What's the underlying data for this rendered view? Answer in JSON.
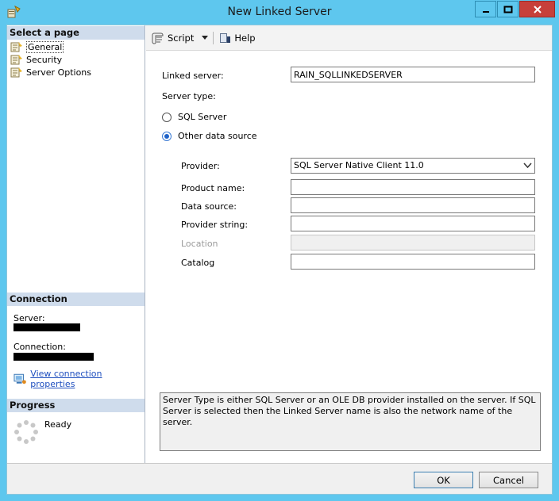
{
  "window": {
    "title": "New Linked Server",
    "controls": {
      "minimize": "minimize",
      "maximize": "maximize",
      "close": "close"
    }
  },
  "left_pane": {
    "select_page_header": "Select a page",
    "pages": [
      {
        "label": "General",
        "selected": true
      },
      {
        "label": "Security",
        "selected": false
      },
      {
        "label": "Server Options",
        "selected": false
      }
    ],
    "connection_header": "Connection",
    "server_label": "Server:",
    "connection_label": "Connection:",
    "view_connection_properties": "View connection properties",
    "progress_header": "Progress",
    "progress_status": "Ready"
  },
  "toolbar": {
    "script_label": "Script",
    "help_label": "Help"
  },
  "form": {
    "linked_server_label": "Linked server:",
    "linked_server_value": "RAIN_SQLLINKEDSERVER",
    "server_type_label": "Server type:",
    "server_type_options": [
      {
        "label": "SQL Server",
        "checked": false
      },
      {
        "label": "Other data source",
        "checked": true
      }
    ],
    "provider_label": "Provider:",
    "provider_value": "SQL Server Native Client 11.0",
    "product_name_label": "Product name:",
    "product_name_value": "",
    "data_source_label": "Data source:",
    "data_source_value": "",
    "provider_string_label": "Provider string:",
    "provider_string_value": "",
    "location_label": "Location",
    "location_value": "",
    "catalog_label": "Catalog",
    "catalog_value": ""
  },
  "description": "Server Type is either SQL Server or an OLE DB provider installed on the server. If SQL Server is selected then the Linked Server name is also the network name of the server.",
  "buttons": {
    "ok": "OK",
    "cancel": "Cancel"
  },
  "colors": {
    "title_bar": "#5ec7ee",
    "section_header": "#cfdcec",
    "link": "#1f4fbf",
    "close_button": "#c7403a"
  }
}
